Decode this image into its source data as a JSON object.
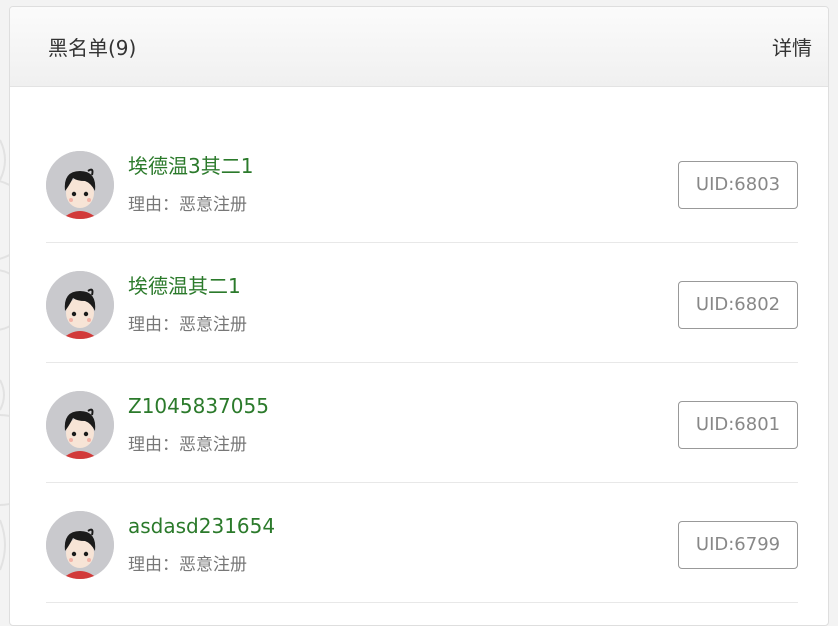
{
  "header": {
    "title": "黑名单(9)",
    "detail_label": "详情"
  },
  "blacklist": [
    {
      "name": "埃德温3其二1",
      "reason": "理由：恶意注册",
      "uid": "UID:6803"
    },
    {
      "name": "埃德温其二1",
      "reason": "理由：恶意注册",
      "uid": "UID:6802"
    },
    {
      "name": "Z1045837055",
      "reason": "理由：恶意注册",
      "uid": "UID:6801"
    },
    {
      "name": "asdasd231654",
      "reason": "理由：恶意注册",
      "uid": "UID:6799"
    }
  ],
  "colors": {
    "name": "#2b7a2b",
    "reason": "#777777",
    "uid_border": "#999999"
  },
  "icons": {
    "avatar": "cartoon-boy-avatar"
  }
}
